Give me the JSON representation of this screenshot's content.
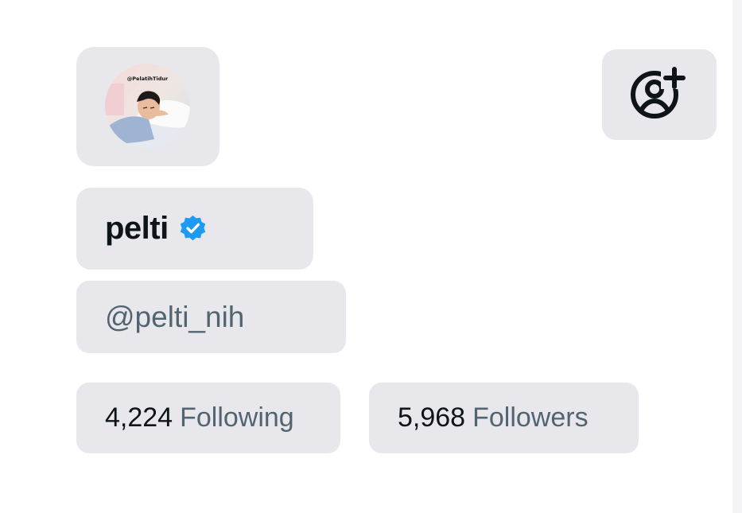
{
  "profile": {
    "avatar_caption": "@PelatihTidur",
    "display_name": "pelti",
    "verified": true,
    "handle": "@pelti_nih"
  },
  "stats": {
    "following_count": "4,224",
    "following_label": "Following",
    "followers_count": "5,968",
    "followers_label": "Followers"
  },
  "icons": {
    "follow": "add-user-icon",
    "verified": "verified-badge-icon"
  },
  "colors": {
    "chip_background": "#e8e8ec",
    "verified_blue": "#1d9bf0",
    "text_primary": "#0f1419",
    "text_secondary": "#536471"
  }
}
